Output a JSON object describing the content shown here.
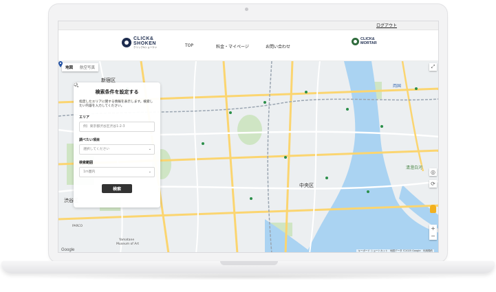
{
  "header": {
    "logout": "ログアウト",
    "logo_line1": "CLICK&",
    "logo_line2": "SHOKEN",
    "logo_sub": "クリック&ショーケン",
    "nav": [
      "TOP",
      "料金・マイページ",
      "お問い合わせ"
    ],
    "logo2_line1": "CLICK&",
    "logo2_line2": "MORTAR"
  },
  "map": {
    "tabs": {
      "map": "地図",
      "satellite": "航空写真"
    },
    "labels": {
      "shinjuku": "新宿区",
      "chuo": "中央区",
      "shibuya": "渋谷区",
      "parco": "PARCO",
      "yamatane": "Yamatane",
      "museum": "Museum of Art",
      "ryogoku": "両国",
      "kiyosumi": "清澄白河"
    },
    "footer_google": "Google",
    "footer_attrib": "キーボード ショートカット　地図データ ©2025 Google　利用規約"
  },
  "search_panel": {
    "title": "検索条件を設定する",
    "description": "指定したエリアに関する情報を表示します。検索したい内容を入力してください。",
    "area_label": "エリア",
    "area_placeholder": "例）東京都渋谷区渋谷1-2-3",
    "topic_label": "調べたい項目",
    "topic_value": "選択してください",
    "range_label": "検索範囲",
    "range_value": "1m圏内",
    "button": "検索"
  },
  "colors": {
    "brand_navy": "#1e2d4f",
    "brand_green": "#2f6b3c",
    "button_dark": "#333333"
  }
}
